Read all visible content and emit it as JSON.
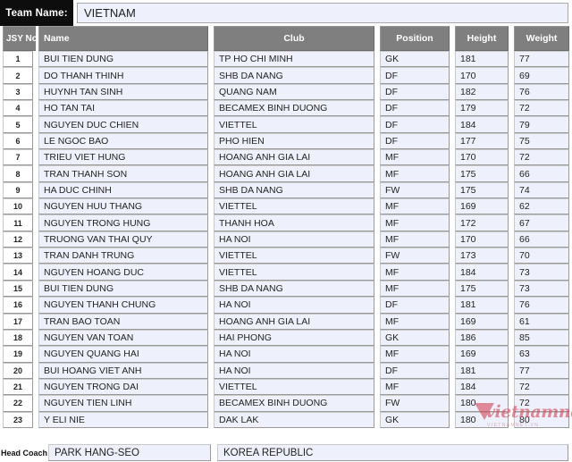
{
  "team": {
    "label": "Team Name:",
    "value": "VIETNAM"
  },
  "columns": {
    "jsy": "JSY No.",
    "name": "Name",
    "club": "Club",
    "position": "Position",
    "height": "Height",
    "weight": "Weight"
  },
  "players": [
    {
      "no": "1",
      "name": "BUI TIEN DUNG",
      "club": "TP HO CHI MINH",
      "position": "GK",
      "height": "181",
      "weight": "77"
    },
    {
      "no": "2",
      "name": "DO THANH THINH",
      "club": "SHB DA NANG",
      "position": "DF",
      "height": "170",
      "weight": "69"
    },
    {
      "no": "3",
      "name": "HUYNH TAN SINH",
      "club": "QUANG NAM",
      "position": "DF",
      "height": "182",
      "weight": "76"
    },
    {
      "no": "4",
      "name": "HO TAN TAI",
      "club": "BECAMEX BINH DUONG",
      "position": "DF",
      "height": "179",
      "weight": "72"
    },
    {
      "no": "5",
      "name": "NGUYEN DUC CHIEN",
      "club": "VIETTEL",
      "position": "DF",
      "height": "184",
      "weight": "79"
    },
    {
      "no": "6",
      "name": "LE NGOC BAO",
      "club": "PHO HIEN",
      "position": "DF",
      "height": "177",
      "weight": "75"
    },
    {
      "no": "7",
      "name": "TRIEU VIET HUNG",
      "club": "HOANG ANH GIA LAI",
      "position": "MF",
      "height": "170",
      "weight": "72"
    },
    {
      "no": "8",
      "name": "TRAN THANH SON",
      "club": "HOANG ANH GIA LAI",
      "position": "MF",
      "height": "175",
      "weight": "66"
    },
    {
      "no": "9",
      "name": "HA DUC CHINH",
      "club": "SHB DA NANG",
      "position": "FW",
      "height": "175",
      "weight": "74"
    },
    {
      "no": "10",
      "name": "NGUYEN HUU THANG",
      "club": "VIETTEL",
      "position": "MF",
      "height": "169",
      "weight": "62"
    },
    {
      "no": "11",
      "name": "NGUYEN TRONG HUNG",
      "club": " THANH HOA",
      "position": "MF",
      "height": "172",
      "weight": "67"
    },
    {
      "no": "12",
      "name": "TRUONG VAN THAI QUY",
      "club": "HA NOI",
      "position": "MF",
      "height": "170",
      "weight": "66"
    },
    {
      "no": "13",
      "name": "TRAN DANH TRUNG",
      "club": "VIETTEL",
      "position": "FW",
      "height": "173",
      "weight": "70"
    },
    {
      "no": "14",
      "name": "NGUYEN HOANG DUC",
      "club": "VIETTEL",
      "position": "MF",
      "height": "184",
      "weight": "73"
    },
    {
      "no": "15",
      "name": "BUI TIEN DUNG",
      "club": "SHB DA NANG",
      "position": "MF",
      "height": "175",
      "weight": "73"
    },
    {
      "no": "16",
      "name": "NGUYEN THANH CHUNG",
      "club": "HA NOI",
      "position": "DF",
      "height": "181",
      "weight": "76"
    },
    {
      "no": "17",
      "name": "TRAN BAO TOAN",
      "club": "HOANG ANH GIA LAI",
      "position": "MF",
      "height": "169",
      "weight": "61"
    },
    {
      "no": "18",
      "name": "NGUYEN VAN TOAN",
      "club": "HAI PHONG",
      "position": "GK",
      "height": "186",
      "weight": "85"
    },
    {
      "no": "19",
      "name": "NGUYEN QUANG HAI",
      "club": "HA NOI",
      "position": "MF",
      "height": "169",
      "weight": "63"
    },
    {
      "no": "20",
      "name": "BUI HOANG VIET ANH",
      "club": "HA NOI",
      "position": "DF",
      "height": "181",
      "weight": "77"
    },
    {
      "no": "21",
      "name": "NGUYEN TRONG DAI",
      "club": "VIETTEL",
      "position": "MF",
      "height": "184",
      "weight": "72"
    },
    {
      "no": "22",
      "name": "NGUYEN TIEN LINH",
      "club": "BECAMEX BINH DUONG",
      "position": "FW",
      "height": "180",
      "weight": "72"
    },
    {
      "no": "23",
      "name": "Y ELI NIE",
      "club": "DAK LAK",
      "position": "GK",
      "height": "180",
      "weight": "80"
    }
  ],
  "coach": {
    "label": "Head Coach",
    "name": "PARK HANG-SEO",
    "country": "KOREA REPUBLIC"
  },
  "watermark": {
    "text": "vietnamnet",
    "subtext": "VIETNAMNET.VN"
  },
  "colors": {
    "header_gray": "#7f7f7f",
    "cell_bg": "#eef1fb",
    "label_bg": "#0d0d0d",
    "watermark_red": "#d34b5e"
  }
}
